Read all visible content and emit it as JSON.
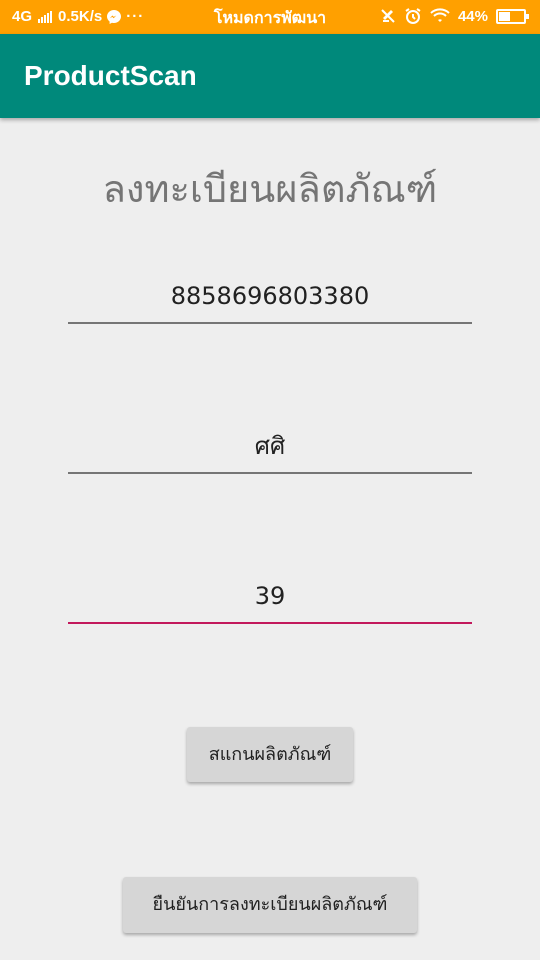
{
  "status_bar": {
    "network": "4G",
    "speed": "0.5K/s",
    "more": "···",
    "mode_text": "โหมดการพัฒนา",
    "battery": "44%"
  },
  "app_bar": {
    "title": "ProductScan"
  },
  "form": {
    "heading": "ลงทะเบียนผลิตภัณฑ์",
    "barcode_value": "8858696803380",
    "name_value": "ศศิ",
    "price_value": "39"
  },
  "buttons": {
    "scan_label": "สแกนผลิตภัณฑ์",
    "confirm_label": "ยืนยันการลงทะเบียนผลิตภัณฑ์"
  },
  "colors": {
    "status_bar": "#FFA000",
    "app_bar": "#00897B",
    "focus_underline": "#C2185B"
  }
}
